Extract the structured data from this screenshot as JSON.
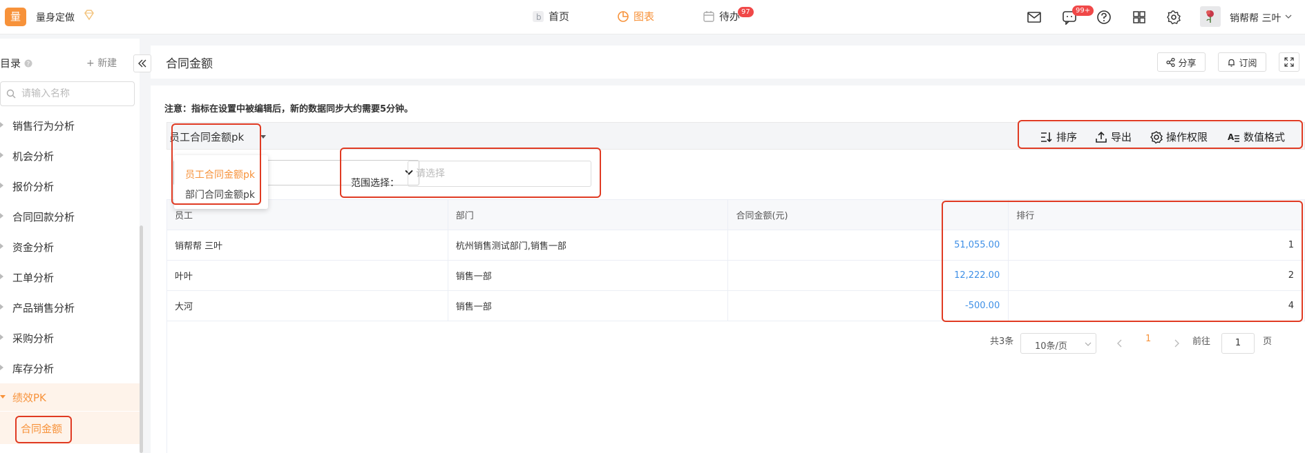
{
  "app": {
    "logo_text": "量",
    "name": "量身定做"
  },
  "nav": {
    "home": "首页",
    "charts": "图表",
    "todo": "待办",
    "todo_badge": "97"
  },
  "topbar": {
    "message_badge": "99+",
    "username": "销帮帮 三叶"
  },
  "sidebar": {
    "title": "目录",
    "new_label": "新建",
    "search_placeholder": "请输入名称",
    "items": [
      {
        "label": "销售行为分析"
      },
      {
        "label": "机会分析"
      },
      {
        "label": "报价分析"
      },
      {
        "label": "合同回款分析"
      },
      {
        "label": "资金分析"
      },
      {
        "label": "工单分析"
      },
      {
        "label": "产品销售分析"
      },
      {
        "label": "采购分析"
      },
      {
        "label": "库存分析"
      },
      {
        "label": "绩效PK"
      }
    ],
    "active_sub": "合同金额"
  },
  "header": {
    "title": "合同金额",
    "share": "分享",
    "subscribe": "订阅"
  },
  "panel": {
    "notice": "注意：指标在设置中被编辑后，新的数据同步大约需要5分钟。",
    "selector_value": "员工合同金额pk",
    "options": [
      "员工合同金额pk",
      "部门合同金额pk"
    ],
    "tools": {
      "sort": "排序",
      "export": "导出",
      "permission": "操作权限",
      "format": "数值格式"
    },
    "range_label": "范围选择：",
    "range_placeholder": "请选择"
  },
  "table": {
    "columns": [
      "员工",
      "部门",
      "合同金额(元)",
      "",
      "排行"
    ],
    "rows": [
      {
        "employee": "销帮帮 三叶",
        "dept": "杭州销售测试部门,销售一部",
        "amount": "51,055.00",
        "rank": "1"
      },
      {
        "employee": "叶叶",
        "dept": "销售一部",
        "amount": "12,222.00",
        "rank": "2"
      },
      {
        "employee": "大河",
        "dept": "销售一部",
        "amount": "-500.00",
        "rank": "4"
      }
    ]
  },
  "pagination": {
    "total": "共3条",
    "page_size": "10条/页",
    "current": "1",
    "goto_label": "前往",
    "goto_value": "1",
    "page_unit": "页"
  },
  "colors": {
    "accent": "#f7923a",
    "highlight_box": "#e03a22",
    "link": "#3e8fe6"
  }
}
